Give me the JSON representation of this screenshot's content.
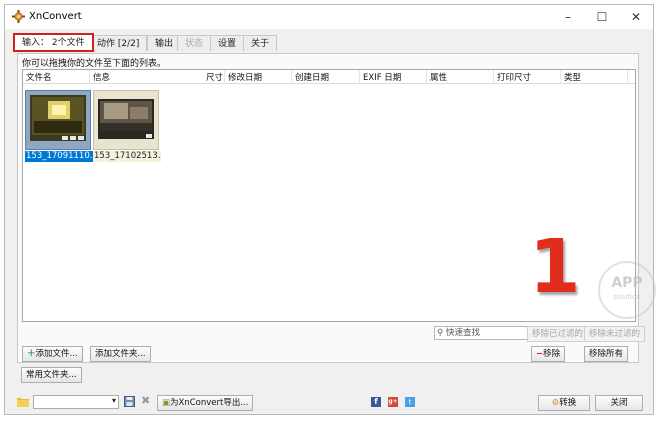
{
  "window": {
    "title": "XnConvert",
    "minimize": "–",
    "maximize": "☐",
    "close": "✕"
  },
  "tabs": [
    {
      "label": "输入： 2个文件",
      "state": "active"
    },
    {
      "label": "动作 [2/2]",
      "state": "normal"
    },
    {
      "label": "输出",
      "state": "normal"
    },
    {
      "label": "状态",
      "state": "disabled"
    },
    {
      "label": "设置",
      "state": "normal"
    },
    {
      "label": "关于",
      "state": "normal"
    }
  ],
  "input": {
    "hint": "你可以拖拽你的文件至下面的列表。",
    "columns": [
      "文件名",
      "信息",
      "尺寸",
      "修改日期",
      "创建日期",
      "EXIF 日期",
      "属性",
      "打印尺寸",
      "类型"
    ],
    "files": [
      {
        "name": "153_17091110...",
        "selected": true
      },
      {
        "name": "153_17102513...",
        "selected": false
      }
    ],
    "search_placeholder": "快速查找",
    "buttons": {
      "remove_filtered": "移除已过滤的",
      "remove_unfiltered": "移除未过滤的",
      "add_file": "添加文件...",
      "add_folder": "添加文件夹...",
      "common_folders": "常用文件夹...",
      "remove": "移除",
      "remove_all": "移除所有"
    }
  },
  "bottom": {
    "export": "为XnConvert导出...",
    "convert": "转换",
    "close": "关闭"
  },
  "overlay": {
    "number": "1",
    "watermark_top": "APP",
    "watermark_bottom": "solution"
  },
  "colors": {
    "accent_red": "#d02020",
    "selection_blue": "#0078d7",
    "big_number": "#e02d1c"
  }
}
